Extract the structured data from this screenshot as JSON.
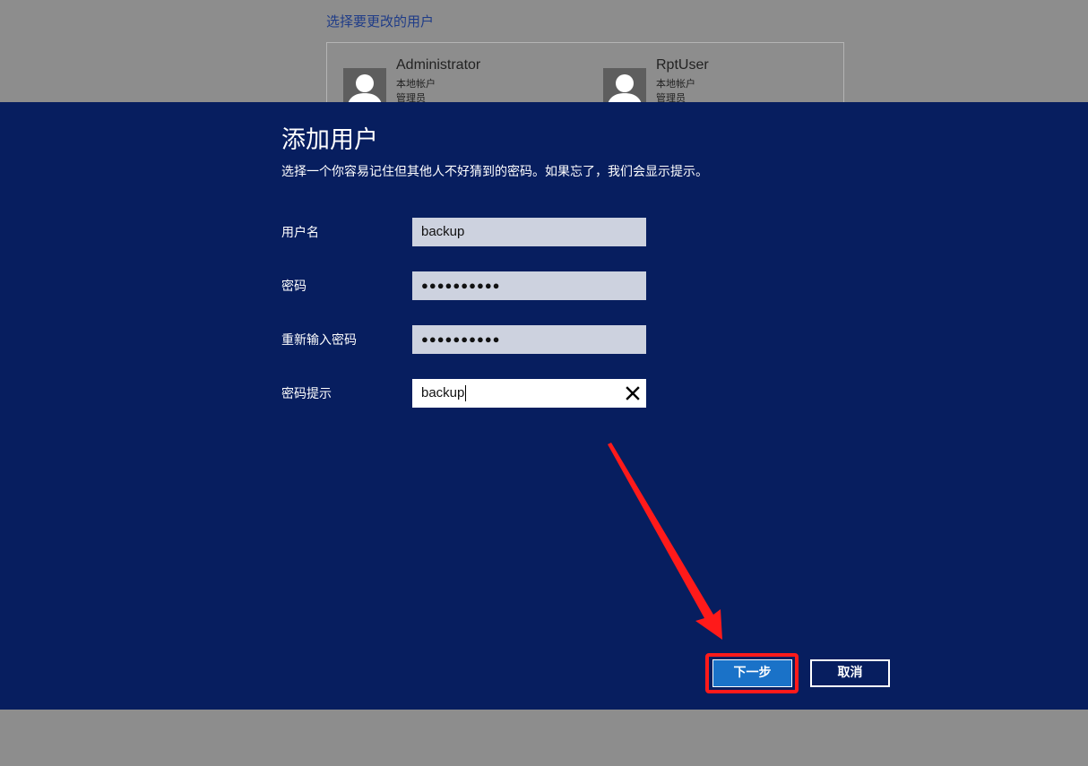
{
  "background": {
    "title": "选择要更改的用户",
    "users": [
      {
        "name": "Administrator",
        "type": "本地帐户",
        "role": "管理员"
      },
      {
        "name": "RptUser",
        "type": "本地帐户",
        "role": "管理员"
      }
    ]
  },
  "dialog": {
    "title": "添加用户",
    "subtitle": "选择一个你容易记住但其他人不好猜到的密码。如果忘了，我们会显示提示。",
    "fields": [
      {
        "label": "用户名",
        "value": "backup"
      },
      {
        "label": "密码",
        "value": "●●●●●●●●●●"
      },
      {
        "label": "重新输入密码",
        "value": "●●●●●●●●●●"
      },
      {
        "label": "密码提示",
        "value": "backup"
      }
    ],
    "next_label": "下一步",
    "cancel_label": "取消"
  },
  "colors": {
    "dialog_bg": "#071e5f",
    "accent_button": "#1a72c8",
    "annotation": "#ff1a1a"
  },
  "icons": {
    "avatar": "user-avatar-icon",
    "clear": "close-icon",
    "annotation": "red-arrow-icon"
  }
}
